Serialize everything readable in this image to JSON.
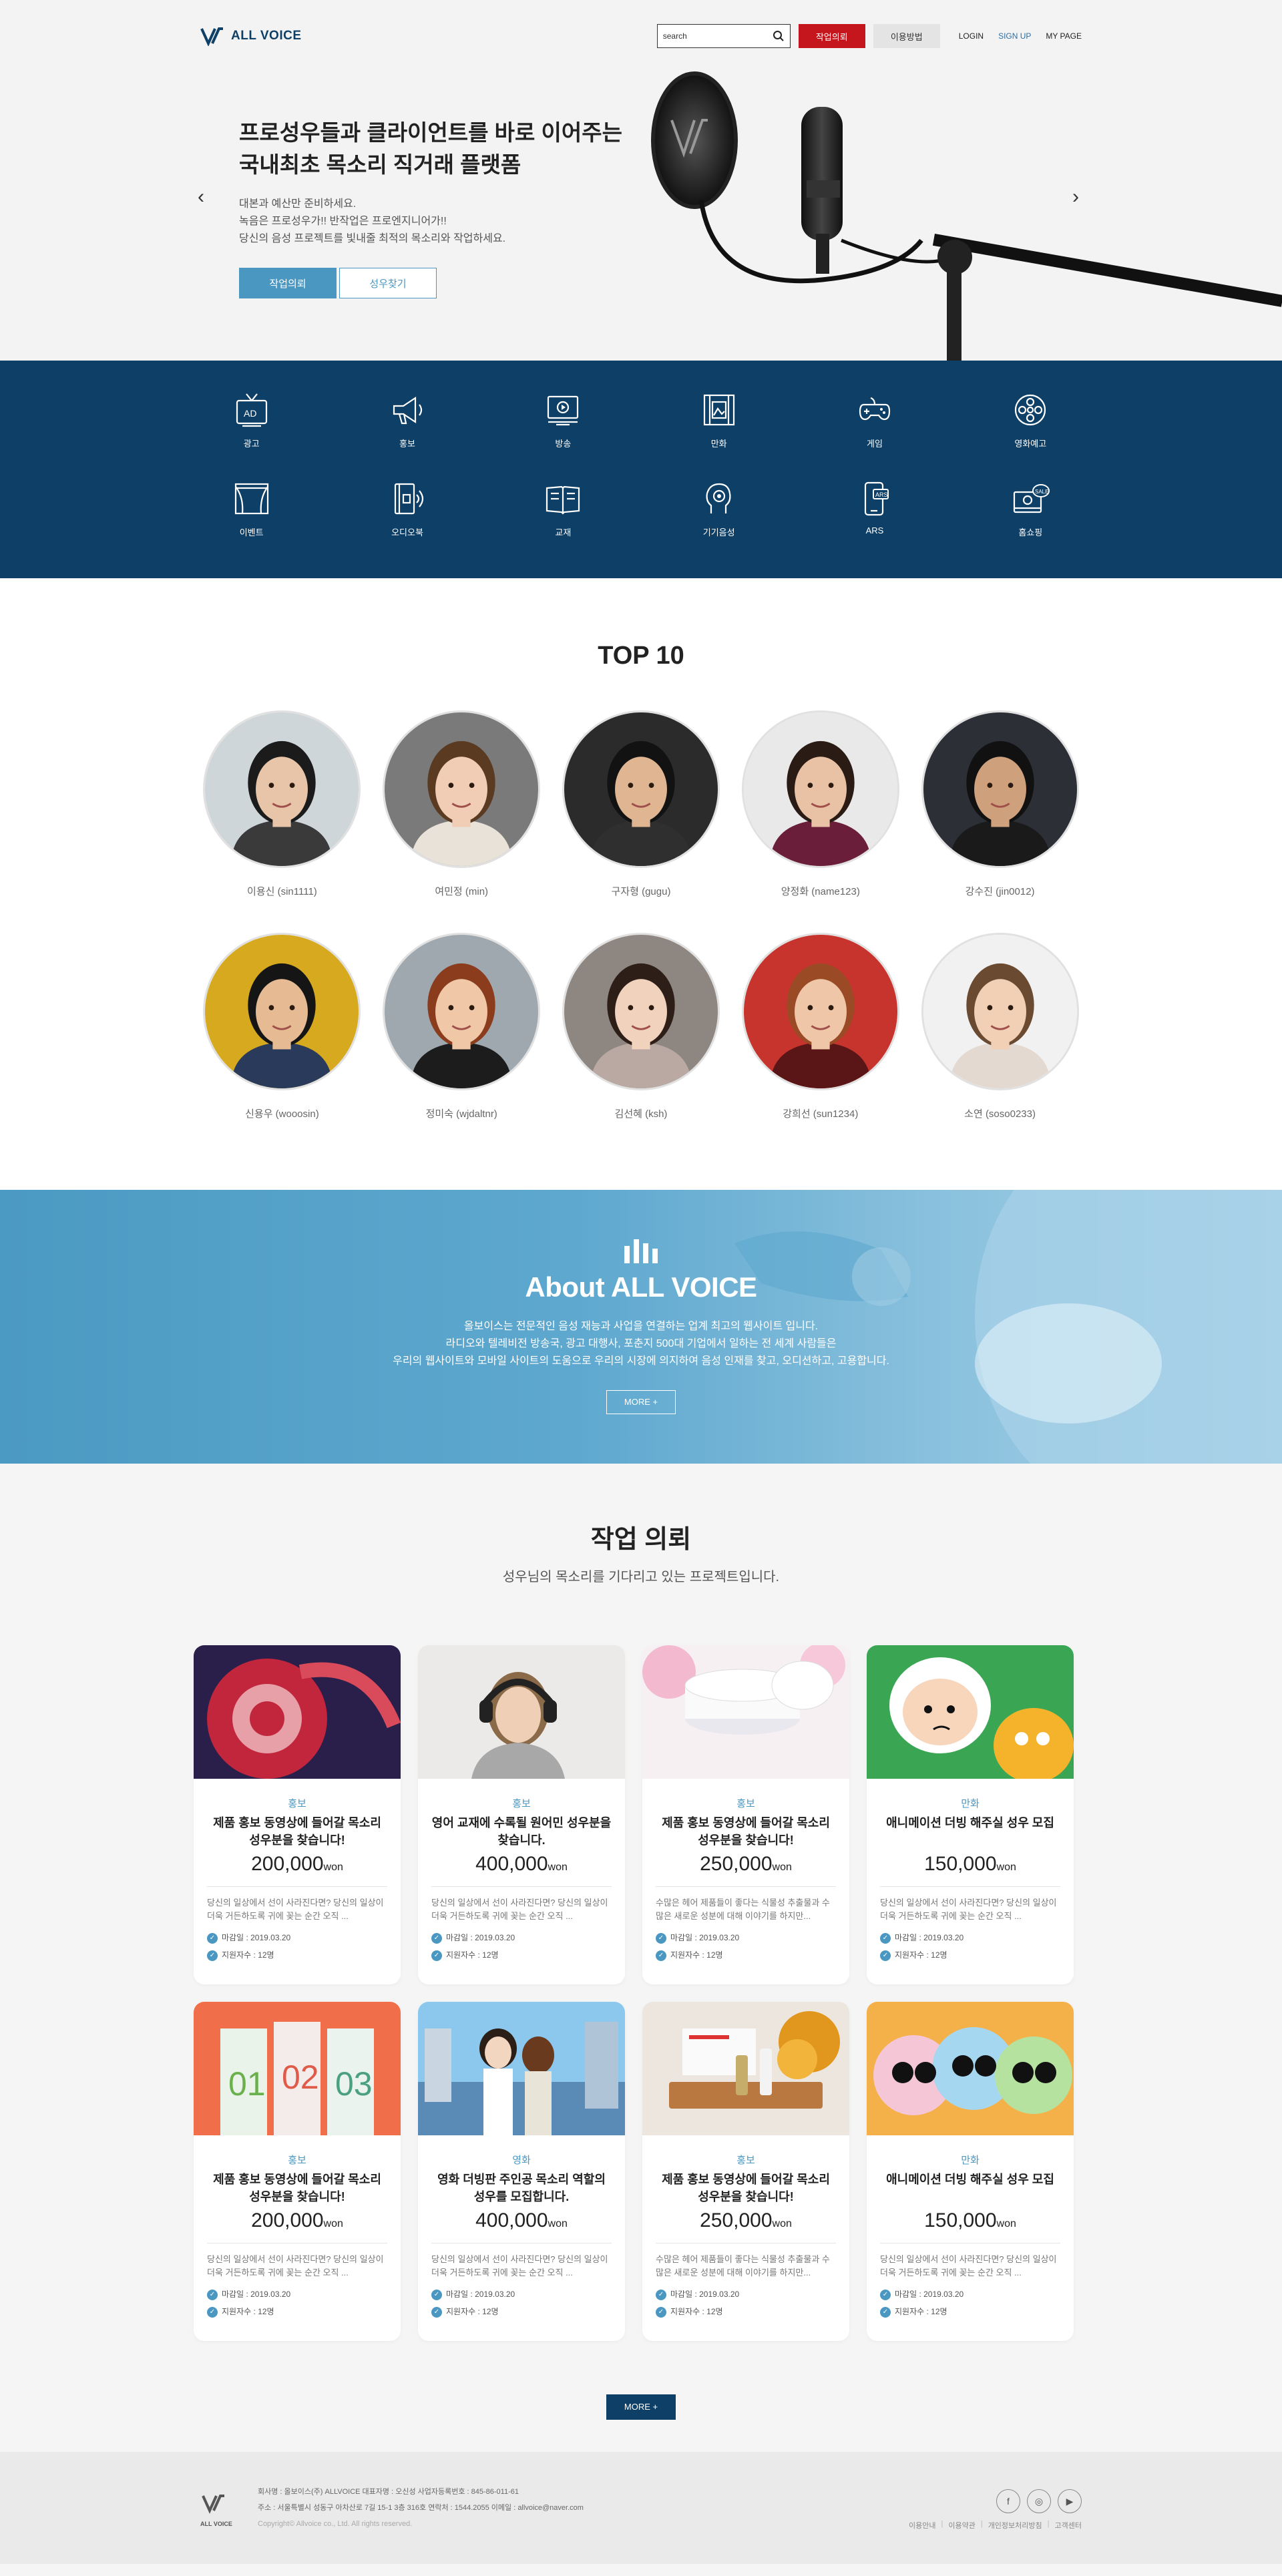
{
  "header": {
    "logo_text": "ALL VOICE",
    "search_placeholder": "search",
    "search_value": "search",
    "request_btn": "작업의뢰",
    "guide_btn": "이용방법",
    "login": "LOGIN",
    "signup": "SIGN UP",
    "mypage": "MY PAGE"
  },
  "hero": {
    "title_line1": "프로성우들과 클라이언트를 바로 이어주는",
    "title_line2": "국내최초 목소리 직거래 플랫폼",
    "desc_line1": "대본과 예산만 준비하세요.",
    "desc_line2": "녹음은 프로성우가!! 반작업은 프로엔지니어가!!",
    "desc_line3": "당신의 음성 프로젝트를 빛내줄 최적의 목소리와 작업하세요.",
    "btn_request": "작업의뢰",
    "btn_find": "성우찾기",
    "prev_arrow": "‹",
    "next_arrow": "›"
  },
  "categories": [
    {
      "label": "광고",
      "icon": "ad-tv-icon"
    },
    {
      "label": "홍보",
      "icon": "megaphone-icon"
    },
    {
      "label": "방송",
      "icon": "broadcast-icon"
    },
    {
      "label": "만화",
      "icon": "film-icon"
    },
    {
      "label": "게임",
      "icon": "gamepad-icon"
    },
    {
      "label": "영화예고",
      "icon": "film-reel-icon"
    },
    {
      "label": "이벤트",
      "icon": "stage-curtain-icon"
    },
    {
      "label": "오디오북",
      "icon": "audiobook-icon"
    },
    {
      "label": "교재",
      "icon": "book-icon"
    },
    {
      "label": "기기음성",
      "icon": "device-voice-icon"
    },
    {
      "label": "ARS",
      "icon": "ars-phone-icon"
    },
    {
      "label": "홈쇼핑",
      "icon": "home-shopping-icon"
    }
  ],
  "top10": {
    "title": "TOP 10",
    "people": [
      {
        "name": "이용신 (sin1111)"
      },
      {
        "name": "여민정 (min)"
      },
      {
        "name": "구자형 (gugu)"
      },
      {
        "name": "양정화 (name123)"
      },
      {
        "name": "강수진 (jin0012)"
      },
      {
        "name": "신용우 (wooosin)"
      },
      {
        "name": "정미숙 (wjdaltnr)"
      },
      {
        "name": "김선혜 (ksh)"
      },
      {
        "name": "강희선 (sun1234)"
      },
      {
        "name": "소연 (soso0233)"
      }
    ]
  },
  "about": {
    "title": "About ALL VOICE",
    "line1": "올보이스는 전문적인 음성 재능과 사업을 연결하는 업계 최고의 웹사이트 입니다.",
    "line2": "라디오와 텔레비전 방송국, 광고 대행사, 포춘지 500대 기업에서 일하는 전 세계 사람들은",
    "line3": "우리의 웹사이트와 모바일 사이트의 도움으로 우리의 시장에 의지하여 음성 인재를 찾고, 오디션하고, 고용합니다.",
    "more": "MORE +"
  },
  "requests": {
    "title": "작업 의뢰",
    "subtitle": "성우님의 목소리를 기다리고 있는 프로젝트입니다.",
    "more": "MORE +",
    "cards": [
      {
        "category": "홍보",
        "title": "제품 홍보 동영상에 들어갈 목소리 성우분을 찾습니다!",
        "price": "200,000",
        "unit": "won",
        "desc": "당신의 일상에서 선이 사라진다면? 당신의 일상이 더욱 거든하도록 귀에 꽂는 순간 오직 ...",
        "deadline": "마감일 : 2019.03.20",
        "applicants": "지원자수 : 12명"
      },
      {
        "category": "홍보",
        "title": "영어 교재에 수록될 원어민 성우분을 찾습니다.",
        "price": "400,000",
        "unit": "won",
        "desc": "당신의 일상에서 선이 사라진다면? 당신의 일상이 더욱 거든하도록 귀에 꽂는 순간 오직 ...",
        "deadline": "마감일 : 2019.03.20",
        "applicants": "지원자수 : 12명"
      },
      {
        "category": "홍보",
        "title": "제품 홍보 동영상에 들어갈 목소리 성우분을 찾습니다!",
        "price": "250,000",
        "unit": "won",
        "desc": "수많은 헤어 제품들이 좋다는 식물성 추출물과 수많은 새로운 성분에 대해 이야기를 하지만...",
        "deadline": "마감일 : 2019.03.20",
        "applicants": "지원자수 : 12명"
      },
      {
        "category": "만화",
        "title": "애니메이션 더빙 해주실 성우 모집",
        "price": "150,000",
        "unit": "won",
        "desc": "당신의 일상에서 선이 사라진다면? 당신의 일상이 더욱 거든하도록 귀에 꽂는 순간 오직 ...",
        "deadline": "마감일 : 2019.03.20",
        "applicants": "지원자수 : 12명"
      },
      {
        "category": "홍보",
        "title": "제품 홍보 동영상에 들어갈 목소리 성우분을 찾습니다!",
        "price": "200,000",
        "unit": "won",
        "desc": "당신의 일상에서 선이 사라진다면? 당신의 일상이 더욱 거든하도록 귀에 꽂는 순간 오직 ...",
        "deadline": "마감일 : 2019.03.20",
        "applicants": "지원자수 : 12명"
      },
      {
        "category": "영화",
        "title": "영화 더빙판 주인공 목소리 역할의 성우를 모집합니다.",
        "price": "400,000",
        "unit": "won",
        "desc": "당신의 일상에서 선이 사라진다면? 당신의 일상이 더욱 거든하도록 귀에 꽂는 순간 오직 ...",
        "deadline": "마감일 : 2019.03.20",
        "applicants": "지원자수 : 12명"
      },
      {
        "category": "홍보",
        "title": "제품 홍보 동영상에 들어갈 목소리 성우분을 찾습니다!",
        "price": "250,000",
        "unit": "won",
        "desc": "수많은 헤어 제품들이 좋다는 식물성 추출물과 수많은 새로운 성분에 대해 이야기를 하지만...",
        "deadline": "마감일 : 2019.03.20",
        "applicants": "지원자수 : 12명"
      },
      {
        "category": "만화",
        "title": "애니메이션 더빙 해주실 성우 모집",
        "price": "150,000",
        "unit": "won",
        "desc": "당신의 일상에서 선이 사라진다면? 당신의 일상이 더욱 거든하도록 귀에 꽂는 순간 오직 ...",
        "deadline": "마감일 : 2019.03.20",
        "applicants": "지원자수 : 12명"
      }
    ]
  },
  "footer": {
    "logo_text": "ALL VOICE",
    "line1": "회사명 : 올보이스(주) ALLVOICE  대표자명 : 오신성  사업자등록번호 : 845-86-011-61",
    "line2": "주소 : 서울특별시 성동구 아차산로 7길 15-1 3층 316호  연락처 : 1544.2055  이메일 : allvoice@naver.com",
    "copyright": "Copyright© Allvoice co., Ltd. All rights reserved.",
    "sns": [
      {
        "icon": "facebook-icon",
        "glyph": "f"
      },
      {
        "icon": "instagram-icon",
        "glyph": "◎"
      },
      {
        "icon": "youtube-icon",
        "glyph": "▶"
      }
    ],
    "links": [
      "이용안내",
      "이용약관",
      "개인정보처리방침",
      "고객센터"
    ]
  },
  "colors": {
    "navy": "#0e3f66",
    "accent_blue": "#4a97c2",
    "red": "#c4161c"
  }
}
